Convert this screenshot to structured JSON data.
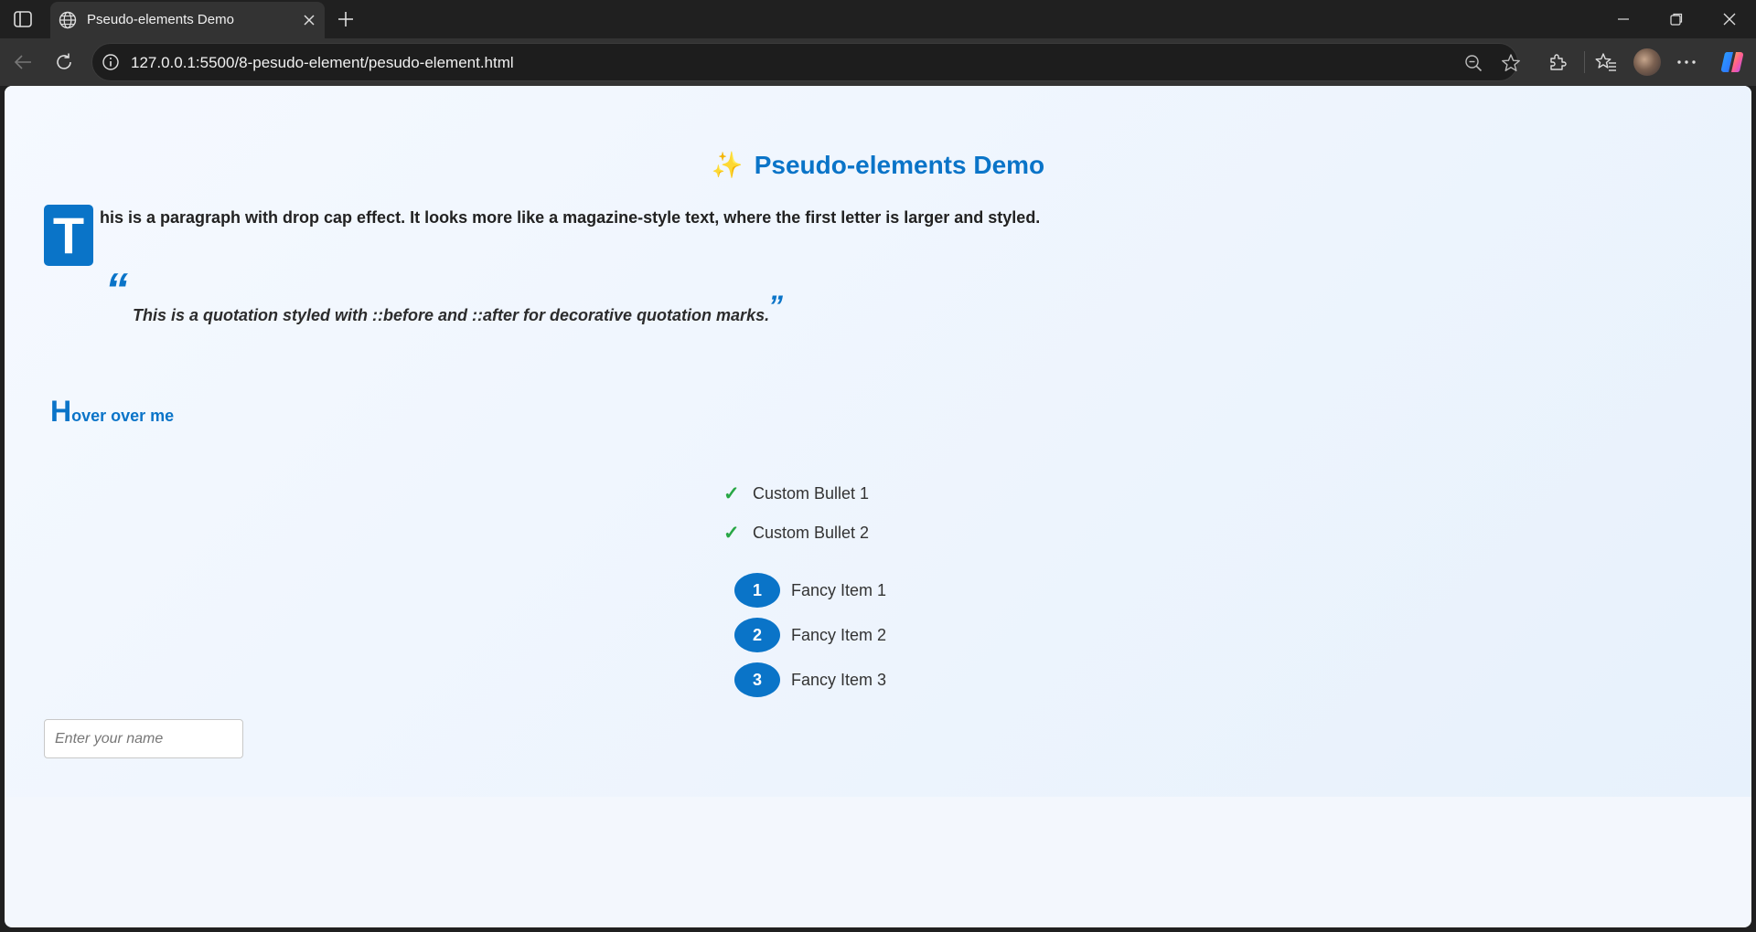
{
  "browser": {
    "tab_title": "Pseudo-elements Demo",
    "url": "127.0.0.1:5500/8-pesudo-element/pesudo-element.html",
    "icons": [
      "sidebar-icon",
      "globe-icon",
      "close-icon",
      "plus-icon",
      "minimize-icon",
      "restore-icon",
      "close-window-icon",
      "back-arrow-icon",
      "reload-icon",
      "info-icon",
      "zoom-out-icon",
      "star-icon",
      "extensions-icon",
      "favorites-icon",
      "more-icon",
      "copilot-icon"
    ]
  },
  "page": {
    "title_emoji": "✨",
    "title": "Pseudo-elements Demo",
    "drop_cap": "T",
    "paragraph_rest": "his is a paragraph with drop cap effect. It looks more like a magazine-style text, where the first letter is larger and styled.",
    "quote_open": "“",
    "quote_text": "This is a quotation styled with ::before and ::after for decorative quotation marks.",
    "quote_close": "”",
    "hover_first": "H",
    "hover_rest": "over over me",
    "check_glyph": "✓",
    "custom_bullets": [
      "Custom Bullet 1",
      "Custom Bullet 2"
    ],
    "fancy_items": [
      {
        "num": "1",
        "label": "Fancy Item 1"
      },
      {
        "num": "2",
        "label": "Fancy Item 2"
      },
      {
        "num": "3",
        "label": "Fancy Item 3"
      }
    ],
    "name_input_placeholder": "Enter your name",
    "name_input_value": ""
  },
  "colors": {
    "accent": "#0a74c8",
    "check": "#28a745"
  }
}
